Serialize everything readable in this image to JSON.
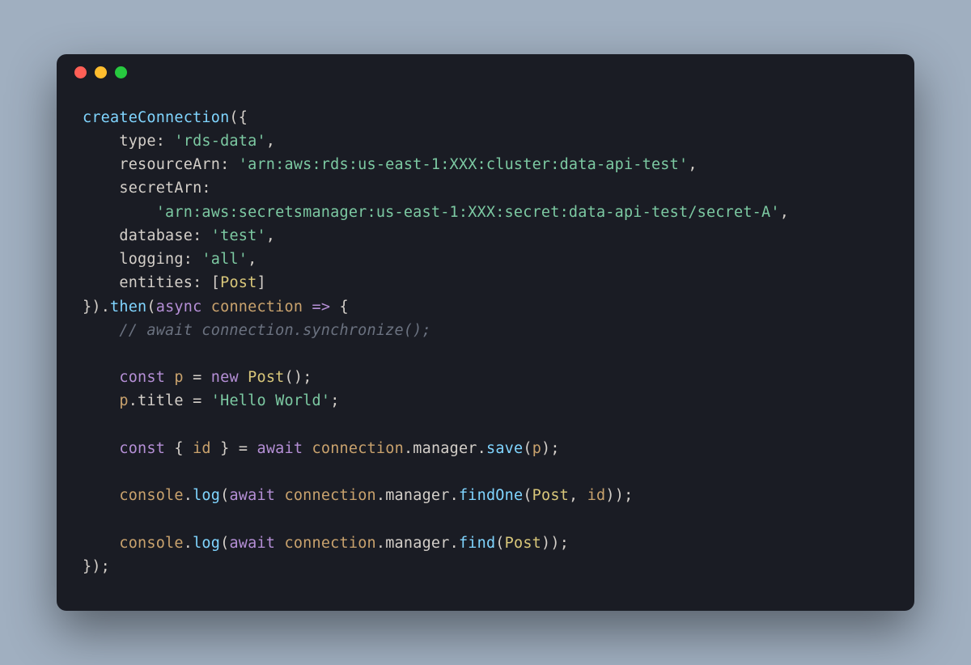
{
  "window": {
    "controls": [
      "close",
      "minimize",
      "zoom"
    ]
  },
  "code": {
    "fn_createConnection": "createConnection",
    "key_type": "type",
    "val_type": "'rds-data'",
    "key_resourceArn": "resourceArn",
    "val_resourceArn": "'arn:aws:rds:us-east-1:XXX:cluster:data-api-test'",
    "key_secretArn": "secretArn",
    "val_secretArn": "'arn:aws:secretsmanager:us-east-1:XXX:secret:data-api-test/secret-A'",
    "key_database": "database",
    "val_database": "'test'",
    "key_logging": "logging",
    "val_logging": "'all'",
    "key_entities": "entities",
    "class_Post": "Post",
    "fn_then": "then",
    "kw_async": "async",
    "ident_connection": "connection",
    "comment_sync": "// await connection.synchronize();",
    "kw_const": "const",
    "ident_p": "p",
    "kw_new": "new",
    "ident_title": "title",
    "val_hello": "'Hello World'",
    "ident_id": "id",
    "kw_await": "await",
    "ident_manager": "manager",
    "fn_save": "save",
    "ident_console": "console",
    "fn_log": "log",
    "fn_findOne": "findOne",
    "fn_find": "find",
    "arrow": "=>",
    "brace_open": "{",
    "brace_close": "}",
    "paren_open": "(",
    "paren_close": ")",
    "bracket_open": "[",
    "bracket_close": "]",
    "comma": ",",
    "colon": ":",
    "semi": ";",
    "dot": ".",
    "eq": "=",
    "brace_close_paren": "})",
    "close_all": "});"
  }
}
